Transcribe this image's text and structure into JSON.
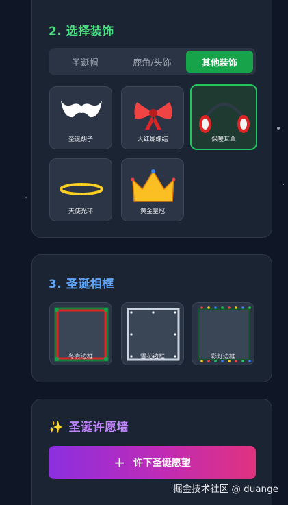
{
  "section_decor": {
    "title": "2. 选择装饰",
    "title_color": "#4ade80",
    "tabs": [
      {
        "label": "圣诞帽",
        "active": false
      },
      {
        "label": "鹿角/头饰",
        "active": false
      },
      {
        "label": "其他装饰",
        "active": true
      }
    ],
    "items": [
      {
        "label": "圣诞胡子",
        "icon": "beard-icon"
      },
      {
        "label": "大红蝴蝶结",
        "icon": "red-bow-icon"
      },
      {
        "label": "保暖耳罩",
        "icon": "earmuffs-icon",
        "selected": true
      },
      {
        "label": "天使光环",
        "icon": "halo-icon"
      },
      {
        "label": "黄金皇冠",
        "icon": "gold-crown-icon"
      }
    ]
  },
  "section_frame": {
    "title": "3. 圣诞相框",
    "title_color": "#60a5fa",
    "frames": [
      {
        "label": "冬青边框",
        "icon": "holly-frame-icon"
      },
      {
        "label": "雪花边框",
        "icon": "snowflake-frame-icon"
      },
      {
        "label": "彩灯边框",
        "icon": "lights-frame-icon"
      }
    ]
  },
  "section_wish": {
    "sparkle": "✨",
    "title": "圣诞许愿墙",
    "title_color": "#c084fc",
    "button_plus": "+",
    "button_label": "许下圣诞愿望"
  },
  "watermark": "掘金技术社区 @ duange"
}
